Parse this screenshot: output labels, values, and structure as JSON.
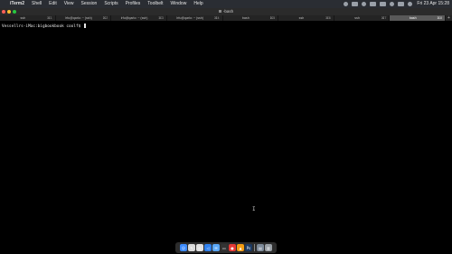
{
  "menubar": {
    "app_name": "iTerm2",
    "menus": [
      "Shell",
      "Edit",
      "View",
      "Session",
      "Scripts",
      "Profiles",
      "Toolbelt",
      "Window",
      "Help"
    ],
    "clock": "Fri 23 Apr  15:28"
  },
  "window": {
    "title": "-bash"
  },
  "tabs": [
    {
      "label": "ssh",
      "shortcut": "⌘1"
    },
    {
      "label": "lrfu@qarlo: ~ (ssh)",
      "shortcut": "⌘2"
    },
    {
      "label": "lrfu@qarlo: ~ (ssh)",
      "shortcut": "⌘3"
    },
    {
      "label": "lrfu@qarlo: ~ (ssh)",
      "shortcut": "⌘4"
    },
    {
      "label": "bash",
      "shortcut": "⌘5"
    },
    {
      "label": "ssh",
      "shortcut": "⌘6"
    },
    {
      "label": "ssh",
      "shortcut": "⌘7"
    },
    {
      "label": "bash",
      "shortcut": "⌘8"
    }
  ],
  "active_tab_index": 7,
  "terminal": {
    "prompt": "Vessellrs-iMac:bigbookbook coolf$"
  },
  "dock": {
    "apps": [
      {
        "name": "finder",
        "glyph": "☺",
        "color": "#3d8bfd"
      },
      {
        "name": "notes",
        "glyph": "✎",
        "color": "#d9d9d9"
      },
      {
        "name": "chrome",
        "glyph": "◎",
        "color": "#e0e0e0"
      },
      {
        "name": "vscode",
        "glyph": "◁",
        "color": "#2f80ed"
      },
      {
        "name": "mail",
        "glyph": "✉",
        "color": "#5aa7f7"
      },
      {
        "name": "terminal",
        "glyph": "▭",
        "color": "#333333"
      },
      {
        "name": "record",
        "glyph": "●",
        "color": "#e53935"
      },
      {
        "name": "vlc",
        "glyph": "▲",
        "color": "#f39c12"
      },
      {
        "name": "photoshop",
        "glyph": "Ps",
        "color": "#1c3a63"
      },
      {
        "name": "documents",
        "glyph": "▤",
        "color": "#7d8a99"
      },
      {
        "name": "trash",
        "glyph": "▥",
        "color": "#9aa0a6"
      }
    ]
  }
}
